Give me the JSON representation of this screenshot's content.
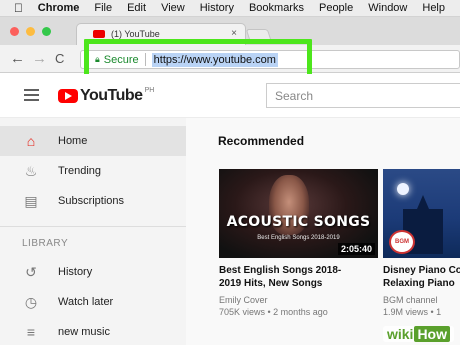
{
  "menubar": {
    "apple_icon": "apple-logo",
    "items": [
      "Chrome",
      "File",
      "Edit",
      "View",
      "History",
      "Bookmarks",
      "People",
      "Window",
      "Help"
    ]
  },
  "tab": {
    "title": "(1) YouTube",
    "close": "×"
  },
  "toolbar": {
    "back": "←",
    "forward": "→",
    "reload": "C"
  },
  "address": {
    "security_label": "Secure",
    "url": "https://www.youtube.com",
    "highlight_color": "#4de61c"
  },
  "youtube": {
    "logo_text": "YouTube",
    "region": "PH",
    "search_placeholder": "Search",
    "accent": "#ff0000"
  },
  "sidebar": {
    "items": [
      {
        "label": "Home",
        "icon": "home-icon"
      },
      {
        "label": "Trending",
        "icon": "flame-icon"
      },
      {
        "label": "Subscriptions",
        "icon": "subscriptions-icon"
      }
    ],
    "library_heading": "LIBRARY",
    "library_items": [
      {
        "label": "History",
        "icon": "history-icon"
      },
      {
        "label": "Watch later",
        "icon": "clock-icon"
      },
      {
        "label": "new music",
        "icon": "playlist-icon"
      }
    ]
  },
  "main": {
    "section_title": "Recommended",
    "videos": [
      {
        "thumb_title": "ACOUSTIC SONGS",
        "thumb_subtitle": "Best English Songs 2018-2019",
        "duration": "2:05:40",
        "title_lines": [
          "Best English Songs 2018-",
          "2019 Hits, New Songs"
        ],
        "channel": "Emily Cover",
        "meta": "705K views • 2 months ago"
      },
      {
        "badge": "BGM",
        "title_lines": [
          "Disney Piano Co",
          "Relaxing Piano"
        ],
        "channel": "BGM channel",
        "meta": "1.9M views • 1"
      }
    ]
  },
  "watermark": {
    "wiki": "wiki",
    "how": "How"
  }
}
